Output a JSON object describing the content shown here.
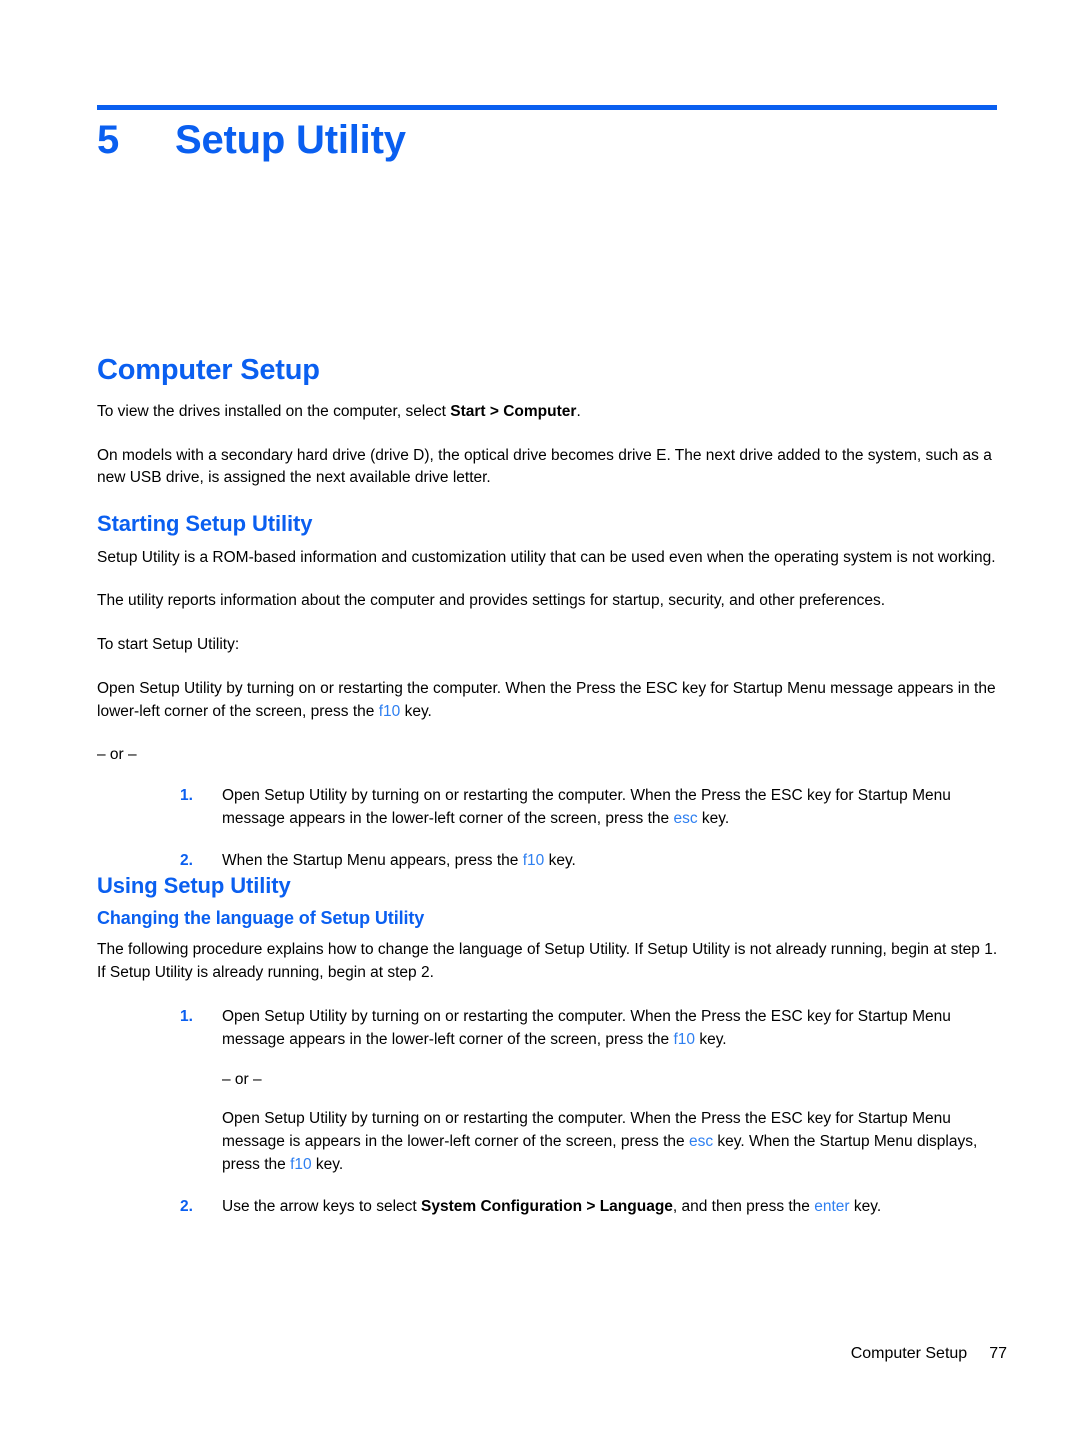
{
  "colors": {
    "heading_blue": "#0a5ff0",
    "key_blue": "#2e7ff0",
    "rule_blue": "#0a5ff0",
    "body_text": "#000000"
  },
  "chapter": {
    "number": "5",
    "title": "Setup Utility"
  },
  "sections": {
    "computer_setup": {
      "heading": "Computer Setup",
      "paragraph_1_prefix": "To view the drives installed on the computer, select ",
      "paragraph_1_bold": "Start > Computer",
      "paragraph_1_suffix": ".",
      "paragraph_2": "On models with a secondary hard drive (drive D), the optical drive becomes drive E. The next drive added to the system, such as a new USB drive, is assigned the next available drive letter."
    },
    "starting_setup_utility": {
      "heading": "Starting Setup Utility",
      "paragraph_1": "Setup Utility is a ROM-based information and customization utility that can be used even when the operating system is not working.",
      "paragraph_2": "The utility reports information about the computer and provides settings for startup, security, and other preferences.",
      "paragraph_3": "To start Setup Utility:",
      "paragraph_4_prefix": "Open Setup Utility by turning on or restarting the computer. When the Press the ESC key for Startup Menu message appears in the lower-left corner of the screen, press the ",
      "paragraph_4_key": "f10",
      "paragraph_4_suffix": " key.",
      "or_divider": "– or –",
      "steps": [
        {
          "number": "1.",
          "prefix": "Open Setup Utility by turning on or restarting the computer. When the Press the ESC key for Startup Menu message appears in the lower-left corner of the screen, press the ",
          "key": "esc",
          "suffix": " key."
        },
        {
          "number": "2.",
          "prefix": "When the Startup Menu appears, press the ",
          "key": "f10",
          "suffix": " key."
        }
      ]
    },
    "using_setup_utility": {
      "heading": "Using Setup Utility",
      "subsection": {
        "heading": "Changing the language of Setup Utility",
        "paragraph_1": "The following procedure explains how to change the language of Setup Utility. If Setup Utility is not already running, begin at step 1. If Setup Utility is already running, begin at step 2.",
        "step1": {
          "number": "1.",
          "prefix": "Open Setup Utility by turning on or restarting the computer. When the Press the ESC key for Startup Menu message appears in the lower-left corner of the screen, press the ",
          "key": "f10",
          "suffix": " key.",
          "or_divider": "– or –",
          "alt_prefix": "Open Setup Utility by turning on or restarting the computer. When the Press the ESC key for Startup Menu message is appears in the lower-left corner of the screen, press the ",
          "alt_key_1": "esc",
          "alt_middle": " key. When the Startup Menu displays, press the ",
          "alt_key_2": "f10",
          "alt_suffix": " key."
        },
        "step2": {
          "number": "2.",
          "prefix": "Use the arrow keys to select ",
          "bold": "System Configuration > Language",
          "middle": ", and then press the ",
          "key": "enter",
          "suffix": " key."
        }
      }
    }
  },
  "footer": {
    "label": "Computer Setup",
    "page_number": "77"
  }
}
